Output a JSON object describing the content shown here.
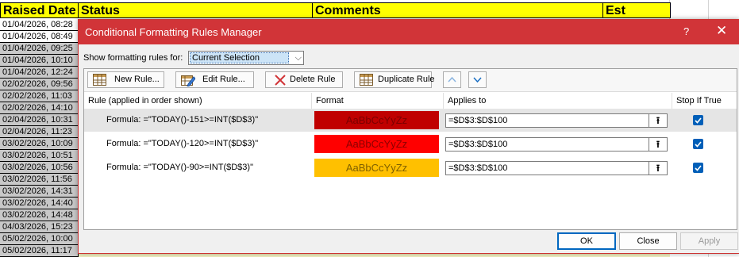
{
  "sheet": {
    "headers": {
      "raised": "Raised Date",
      "status": "Status",
      "comments": "Comments",
      "est": "Est Closure"
    },
    "dates": [
      "01/04/2026, 08:28",
      "01/04/2026, 08:49",
      "01/04/2026, 09:25",
      "01/04/2026, 10:10",
      "01/04/2026, 12:24",
      "02/02/2026, 09:56",
      "02/02/2026, 11:03",
      "02/02/2026, 14:10",
      "02/04/2026, 10:31",
      "02/04/2026, 11:23",
      "03/02/2026, 10:09",
      "03/02/2026, 10:51",
      "03/02/2026, 10:56",
      "03/02/2026, 11:56",
      "03/02/2026, 14:31",
      "03/02/2026, 14:40",
      "03/02/2026, 14:48",
      "04/03/2026, 15:23",
      "05/02/2026, 10:00",
      "05/02/2026, 11:17"
    ]
  },
  "dialog": {
    "title": "Conditional Formatting Rules Manager",
    "help": "?",
    "close": "✕",
    "show_label": "Show formatting rules for:",
    "show_value": "Current Selection",
    "toolbar": {
      "new_rule": "New Rule...",
      "edit_rule": "Edit Rule...",
      "delete_rule": "Delete Rule",
      "duplicate_rule": "Duplicate Rule"
    },
    "columns": {
      "rule": "Rule (applied in order shown)",
      "format": "Format",
      "applies": "Applies to",
      "stop": "Stop If True"
    },
    "rules": [
      {
        "formula": "Formula: =\"TODAY()-151>=INT($D$3)\"",
        "preview": "AaBbCcYyZz",
        "bg": "#c00000",
        "fg": "#7a0000",
        "applies": "=$D$3:$D$100"
      },
      {
        "formula": "Formula: =\"TODAY()-120>=INT($D$3)\"",
        "preview": "AaBbCcYyZz",
        "bg": "#ff0000",
        "fg": "#8b0000",
        "applies": "=$D$3:$D$100"
      },
      {
        "formula": "Formula: =\"TODAY()-90>=INT($D$3)\"",
        "preview": "AaBbCcYyZz",
        "bg": "#ffc000",
        "fg": "#7f5f00",
        "applies": "=$D$3:$D$100"
      }
    ],
    "ok": "OK",
    "close_btn": "Close",
    "apply": "Apply"
  }
}
